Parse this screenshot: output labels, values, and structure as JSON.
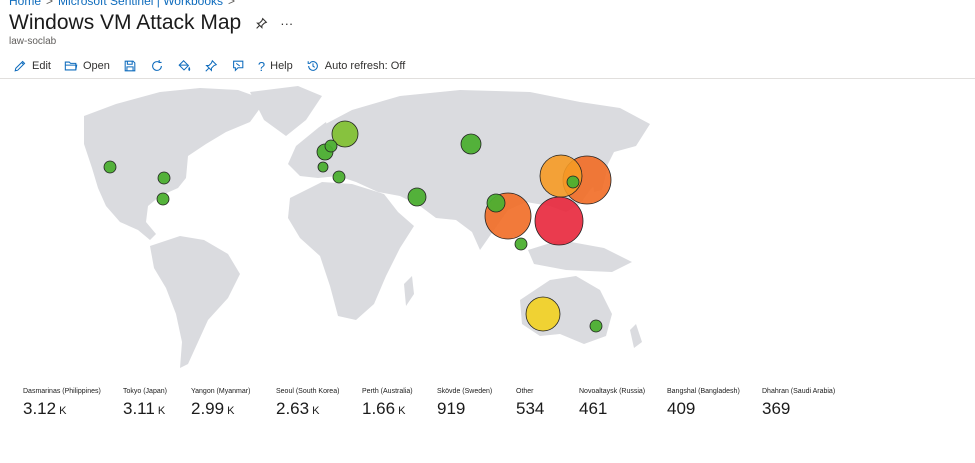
{
  "breadcrumb": {
    "items": [
      "Home",
      "Microsoft Sentinel | Workbooks"
    ]
  },
  "header": {
    "title": "Windows VM Attack Map",
    "subtitle": "law-soclab"
  },
  "toolbar": {
    "edit_label": "Edit",
    "open_label": "Open",
    "help_label": "Help",
    "auto_refresh_label": "Auto refresh: Off"
  },
  "map": {
    "bubbles": [
      {
        "name": "dasmarinas-philippines",
        "color": "#e8263b",
        "count": 3120
      },
      {
        "name": "tokyo-japan",
        "color": "#f16b25",
        "count": 3110
      },
      {
        "name": "yangon-myanmar",
        "color": "#f16b25",
        "count": 2990
      },
      {
        "name": "seoul-south-korea",
        "color": "#f59a25",
        "count": 2630
      },
      {
        "name": "perth-australia",
        "color": "#f2d020",
        "count": 1660
      },
      {
        "name": "skovde-sweden",
        "color": "#7dbf2c",
        "count": 919
      }
    ]
  },
  "stats": [
    {
      "label": "Dasmarinas (Philippines)",
      "value": "3.12",
      "unit": "K"
    },
    {
      "label": "Tokyo (Japan)",
      "value": "3.11",
      "unit": "K"
    },
    {
      "label": "Yangon (Myanmar)",
      "value": "2.99",
      "unit": "K"
    },
    {
      "label": "Seoul (South Korea)",
      "value": "2.63",
      "unit": "K"
    },
    {
      "label": "Perth (Australia)",
      "value": "1.66",
      "unit": "K"
    },
    {
      "label": "Skövde (Sweden)",
      "value": "919",
      "unit": ""
    },
    {
      "label": "Other",
      "value": "534",
      "unit": ""
    },
    {
      "label": "Novoaltaysk (Russia)",
      "value": "461",
      "unit": ""
    },
    {
      "label": "Bangshal (Bangladesh)",
      "value": "409",
      "unit": ""
    },
    {
      "label": "Dhahran (Saudi Arabia)",
      "value": "369",
      "unit": ""
    }
  ]
}
